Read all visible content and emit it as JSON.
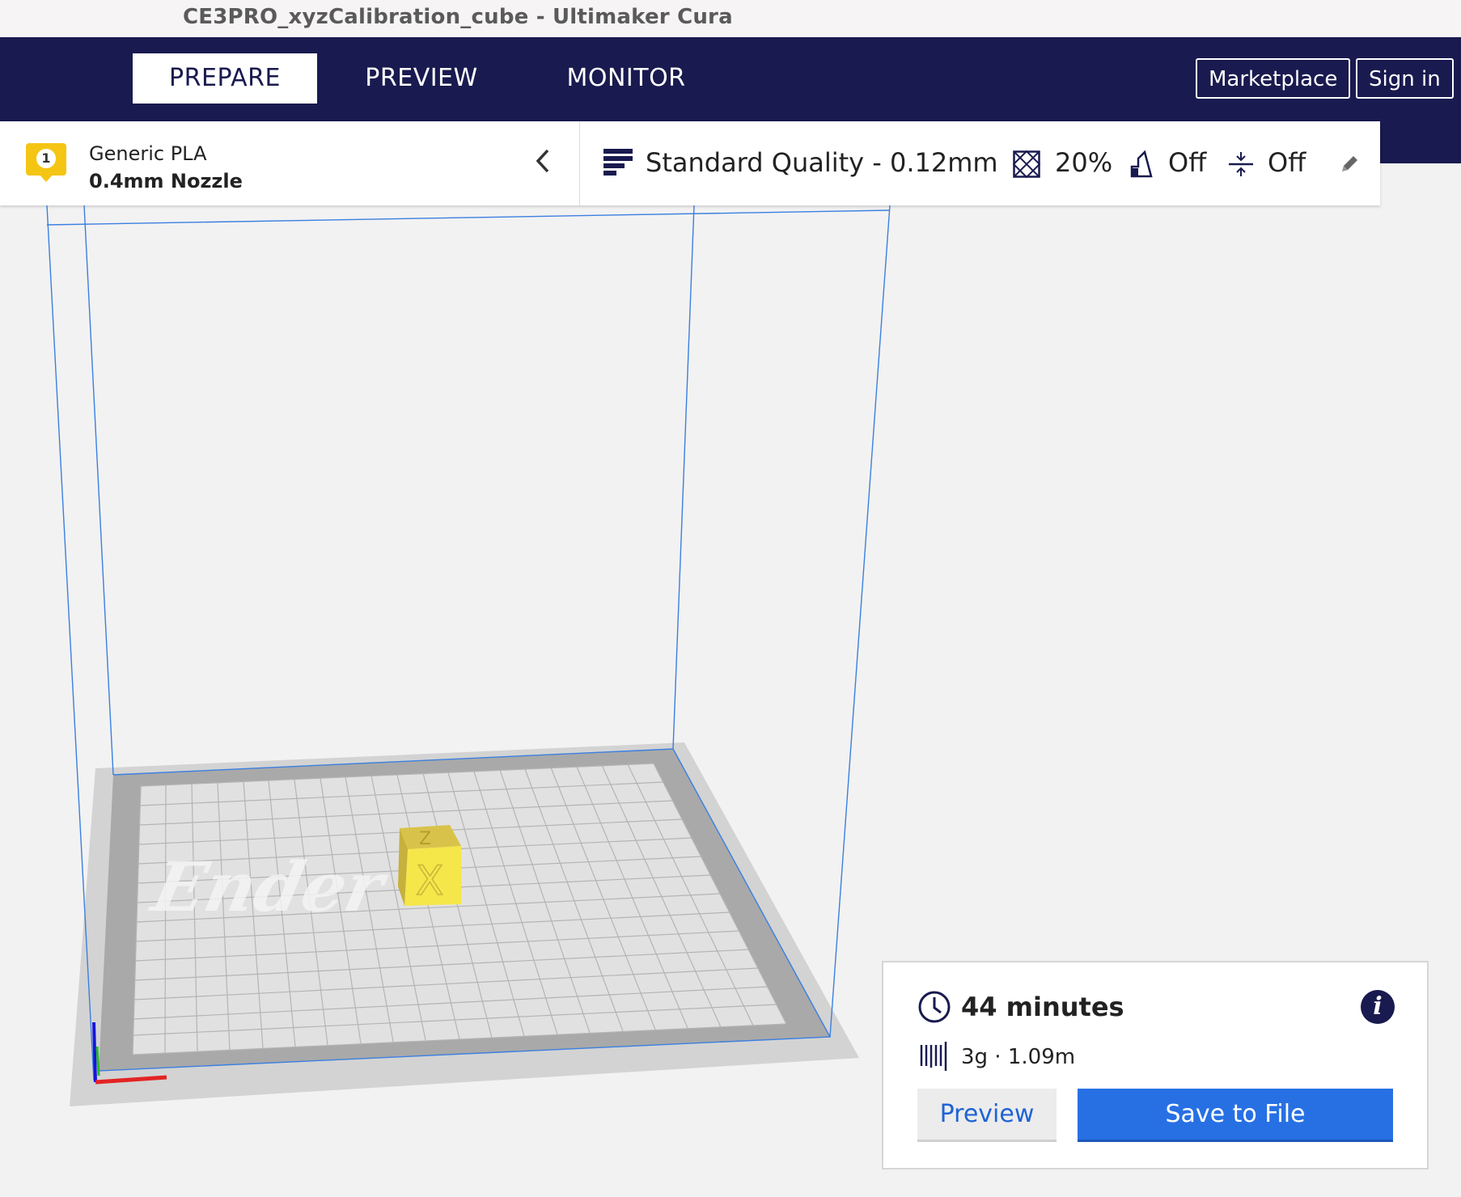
{
  "window": {
    "title": "CE3PRO_xyzCalibration_cube - Ultimaker Cura"
  },
  "header": {
    "tabs": [
      {
        "label": "PREPARE",
        "active": true
      },
      {
        "label": "PREVIEW",
        "active": false
      },
      {
        "label": "MONITOR",
        "active": false
      }
    ],
    "marketplace_label": "Marketplace",
    "signin_label": "Sign in"
  },
  "extruder": {
    "number": "1",
    "material": "Generic PLA",
    "nozzle": "0.4mm Nozzle"
  },
  "print_settings": {
    "quality": "Standard Quality - 0.12mm",
    "infill": "20%",
    "support": "Off",
    "adhesion": "Off"
  },
  "viewport": {
    "model_face_top": "Z",
    "model_face_front": "X",
    "bed_logo_text": "Ender",
    "model_color": "#f5e64a",
    "build_volume_color": "#3b7fe0"
  },
  "print_summary": {
    "time": "44 minutes",
    "material_usage": "3g · 1.09m",
    "preview_label": "Preview",
    "save_label": "Save to File"
  },
  "colors": {
    "navy": "#191a4f",
    "accent_blue": "#2770e4",
    "badge_yellow": "#f5c514"
  }
}
